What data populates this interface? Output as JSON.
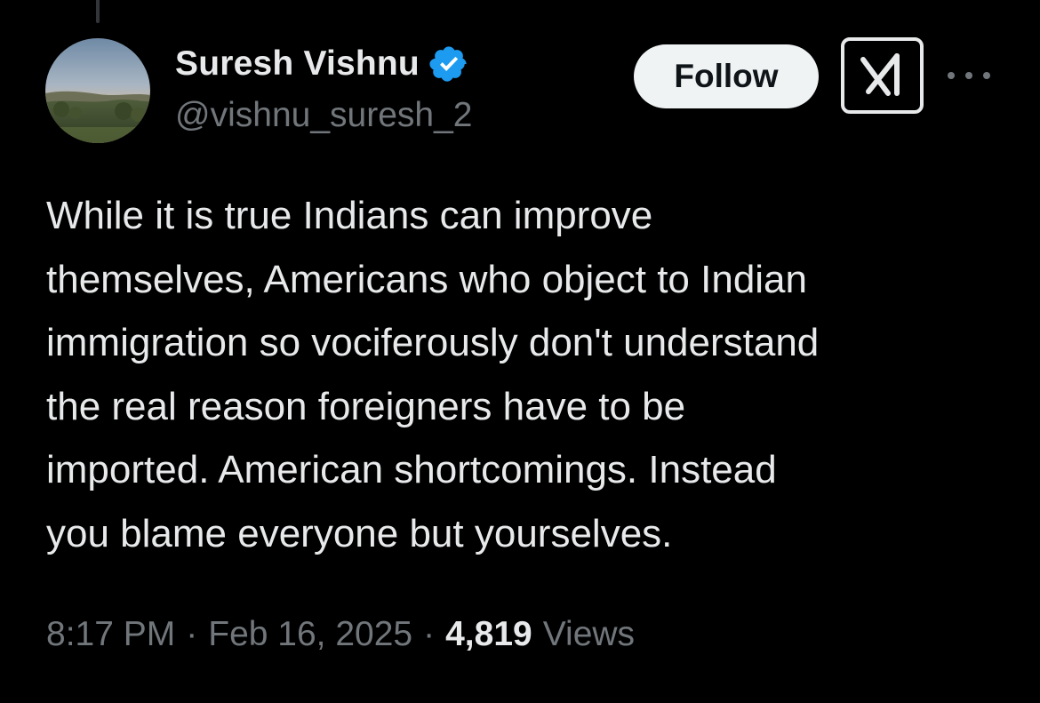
{
  "post": {
    "author": {
      "display_name": "Suresh Vishnu",
      "handle": "@vishnu_suresh_2",
      "verified": true,
      "verified_color": "#1d9bf0"
    },
    "actions": {
      "follow_label": "Follow",
      "grok_icon": "grok-icon",
      "more_icon": "more-options-icon"
    },
    "text_lines": [
      "While it is true Indians can improve",
      "themselves, Americans who object to Indian",
      "immigration so vociferously don't understand",
      "the real reason foreigners have to be",
      "imported. American shortcomings. Instead",
      "you blame everyone but yourselves."
    ],
    "meta": {
      "time": "8:17 PM",
      "separator": "·",
      "date": "Feb 16, 2025",
      "views_count": "4,819",
      "views_label": "Views"
    }
  },
  "colors": {
    "background": "#000000",
    "text_primary": "#e7e9ea",
    "text_secondary": "#71767b",
    "follow_bg": "#eff3f4",
    "follow_text": "#0f1419"
  }
}
